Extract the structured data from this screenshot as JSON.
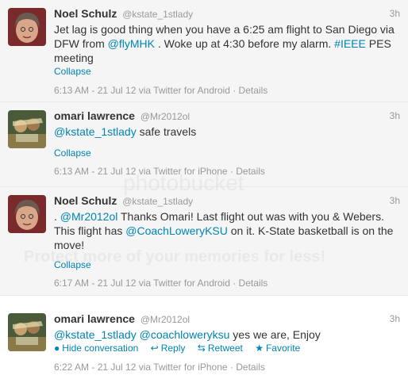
{
  "tweets": [
    {
      "fullname": "Noel Schulz",
      "username": "@kstate_1stlady",
      "time": "3h",
      "text_1": "Jet lag is good thing when you have a 6:25 am flight to San Diego via DFW from ",
      "link_1": "@flyMHK",
      "text_2": " . Woke up at 4:30 before my alarm. ",
      "link_2": "#IEEE",
      "text_3": " PES meeting",
      "collapse": "Collapse",
      "meta": "6:13 AM - 21 Jul 12 via Twitter for Android · Details"
    },
    {
      "fullname": "omari lawrence",
      "username": "@Mr2012ol",
      "time": "3h",
      "link_1": "@kstate_1stlady",
      "text_1": " safe travels",
      "collapse": "Collapse",
      "meta": "6:13 AM - 21 Jul 12 via Twitter for iPhone · Details"
    },
    {
      "fullname": "Noel Schulz",
      "username": "@kstate_1stlady",
      "time": "3h",
      "text_0": ". ",
      "link_1": "@Mr2012ol",
      "text_1": " Thanks Omari! Last flight out was with you & Webers. This flight has ",
      "link_2": "@CoachLoweryKSU",
      "text_2": " on it. K-State basketball is on the move!",
      "collapse": "Collapse",
      "meta": "6:17 AM - 21 Jul 12 via Twitter for Android · Details"
    },
    {
      "fullname": "omari lawrence",
      "username": "@Mr2012ol",
      "time": "3h",
      "link_1": "@kstate_1stlady",
      "link_2": "@coachloweryksu",
      "text_1": " yes we are, Enjoy",
      "actions": {
        "hide": "Hide conversation",
        "reply": "Reply",
        "retweet": "Retweet",
        "favorite": "Favorite"
      },
      "meta": "6:22 AM - 21 Jul 12 via Twitter for iPhone · Details"
    }
  ],
  "watermark": {
    "brand": "photobucket",
    "tagline": "Protect more of your memories for less!"
  },
  "colors": {
    "link": "#0084b4",
    "muted": "#999999",
    "expanded_bg": "#f5f5f5"
  }
}
